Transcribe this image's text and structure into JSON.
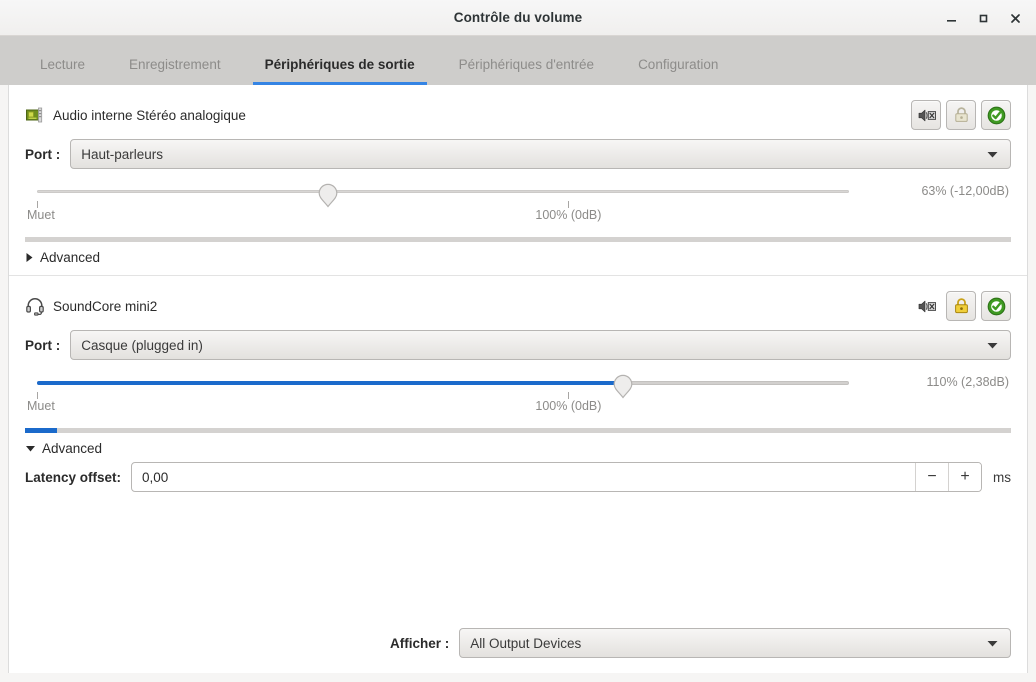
{
  "window": {
    "title": "Contrôle du volume",
    "controls": [
      {
        "name": "minimize",
        "glyph": "_"
      },
      {
        "name": "maximize",
        "glyph": "□"
      },
      {
        "name": "close",
        "glyph": "✕"
      }
    ]
  },
  "tabs": [
    {
      "label": "Lecture",
      "active": false
    },
    {
      "label": "Enregistrement",
      "active": false
    },
    {
      "label": "Périphériques de sortie",
      "active": true
    },
    {
      "label": "Périphériques d'entrée",
      "active": false
    },
    {
      "label": "Configuration",
      "active": false
    }
  ],
  "accent_color": "#3584e4",
  "slider_fill_color": "#1b6acb",
  "devices": [
    {
      "icon": "sound-card-icon",
      "name": "Audio interne Stéréo analogique",
      "port_label": "Port :",
      "port_value": "Haut-parleurs",
      "mute_button": {
        "name": "mute-button",
        "framed": true
      },
      "lock_button": {
        "name": "lock-button",
        "framed": true,
        "active": false
      },
      "default_button": {
        "name": "set-default-button",
        "framed": true,
        "active": true
      },
      "volume": {
        "percent_position": 36.2,
        "fill_percent": 0,
        "value_text": "63% (-12,00dB)",
        "min_label": "Muet",
        "base_label": "100% (0dB)",
        "base_position": 65.0
      },
      "peak_level": 0,
      "advanced": {
        "label": "Advanced",
        "expanded": false
      }
    },
    {
      "icon": "headset-icon",
      "name": "SoundCore mini2",
      "port_label": "Port :",
      "port_value": "Casque (plugged in)",
      "mute_button": {
        "name": "mute-button",
        "framed": false
      },
      "lock_button": {
        "name": "lock-button",
        "framed": true,
        "active": true
      },
      "default_button": {
        "name": "set-default-button",
        "framed": true,
        "active": true
      },
      "volume": {
        "percent_position": 71.5,
        "fill_percent": 71.5,
        "value_text": "110% (2,38dB)",
        "min_label": "Muet",
        "base_label": "100% (0dB)",
        "base_position": 65.0
      },
      "peak_level": 8,
      "advanced": {
        "label": "Advanced",
        "expanded": true
      },
      "latency": {
        "label": "Latency offset:",
        "value": "0,00",
        "decrement": "−",
        "increment": "+",
        "unit": "ms"
      }
    }
  ],
  "footer": {
    "label": "Afficher :",
    "value": "All Output Devices"
  }
}
